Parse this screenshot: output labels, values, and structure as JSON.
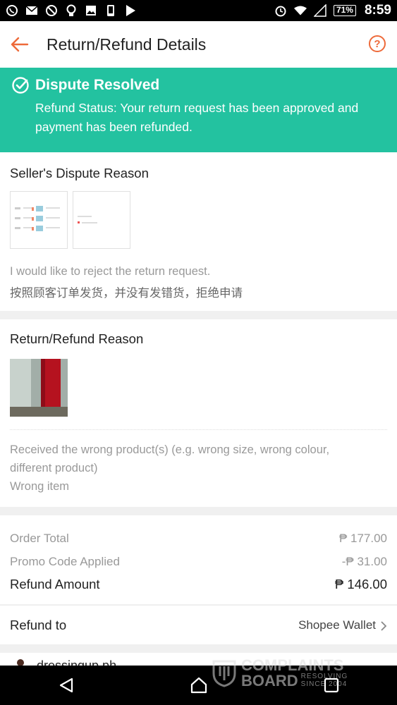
{
  "status_bar": {
    "time": "8:59",
    "battery": "71%",
    "icons": [
      "viber-icon",
      "mail-icon",
      "blocked-icon",
      "bulb-icon",
      "image-icon",
      "phone-icon",
      "play-store-icon",
      "alarm-icon",
      "wifi-icon",
      "signal-icon",
      "battery-icon"
    ]
  },
  "header": {
    "title": "Return/Refund Details",
    "help_label": "?"
  },
  "banner": {
    "title": "Dispute Resolved",
    "text": "Refund Status: Your return request has been approved and payment has been refunded.",
    "color": "#23c2a0"
  },
  "seller_section": {
    "title": "Seller's Dispute Reason",
    "reason_en": "I would like to reject the return request.",
    "reason_cn": "按照顾客订单发货，并没有发错货，拒绝申请"
  },
  "refund_section": {
    "title": "Return/Refund Reason",
    "reason_line1": "Received the wrong product(s) (e.g. wrong size, wrong colour,",
    "reason_line2": "different product)",
    "reason_line3": "Wrong item"
  },
  "summary": {
    "order_total_label": "Order Total",
    "order_total_value": "₱ 177.00",
    "promo_label": "Promo Code Applied",
    "promo_value": "-₱ 31.00",
    "refund_label": "Refund Amount",
    "refund_value": "₱ 146.00"
  },
  "refund_to": {
    "label": "Refund to",
    "value": "Shopee Wallet"
  },
  "shop": {
    "name": "dressingup.ph"
  },
  "watermark": {
    "line1": "COMPLAINTS",
    "line2": "BOARD",
    "tag1": "RESOLVING",
    "tag2": "SINCE 2004"
  },
  "accent_color": "#ee6a3a"
}
